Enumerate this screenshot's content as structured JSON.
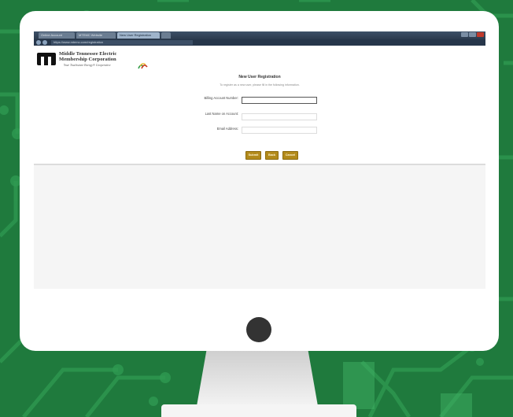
{
  "browser": {
    "tabs": [
      {
        "label": "Online Account",
        "active": false
      },
      {
        "label": "MTEMC Website",
        "active": false
      },
      {
        "label": "New User Registration",
        "active": true
      },
      {
        "label": "",
        "active": false
      }
    ],
    "url": "https://www.mtemc.com/registration"
  },
  "page": {
    "logo": {
      "line1": "Middle Tennessee Electric",
      "line2": "Membership Corporation",
      "tagline": "Your Touchstone Energy® Cooperative"
    },
    "form": {
      "title": "New User Registration",
      "intro": "To register as a new user, please fill in the following information.",
      "fields": [
        {
          "label": "Billing Account Number:",
          "value": ""
        },
        {
          "label": "Last Name on Account:",
          "value": ""
        },
        {
          "label": "Email Address:",
          "value": ""
        }
      ],
      "buttons": {
        "submit": "Submit",
        "back": "Back",
        "cancel": "Cancel"
      }
    }
  },
  "colors": {
    "background": "#1f7a3d",
    "button": "#b28a1b",
    "titlebar": "#2b3a4d"
  },
  "icons": [
    "circuit-pattern",
    "camera-dot",
    "logo-mark",
    "logo-swirl-icon"
  ]
}
